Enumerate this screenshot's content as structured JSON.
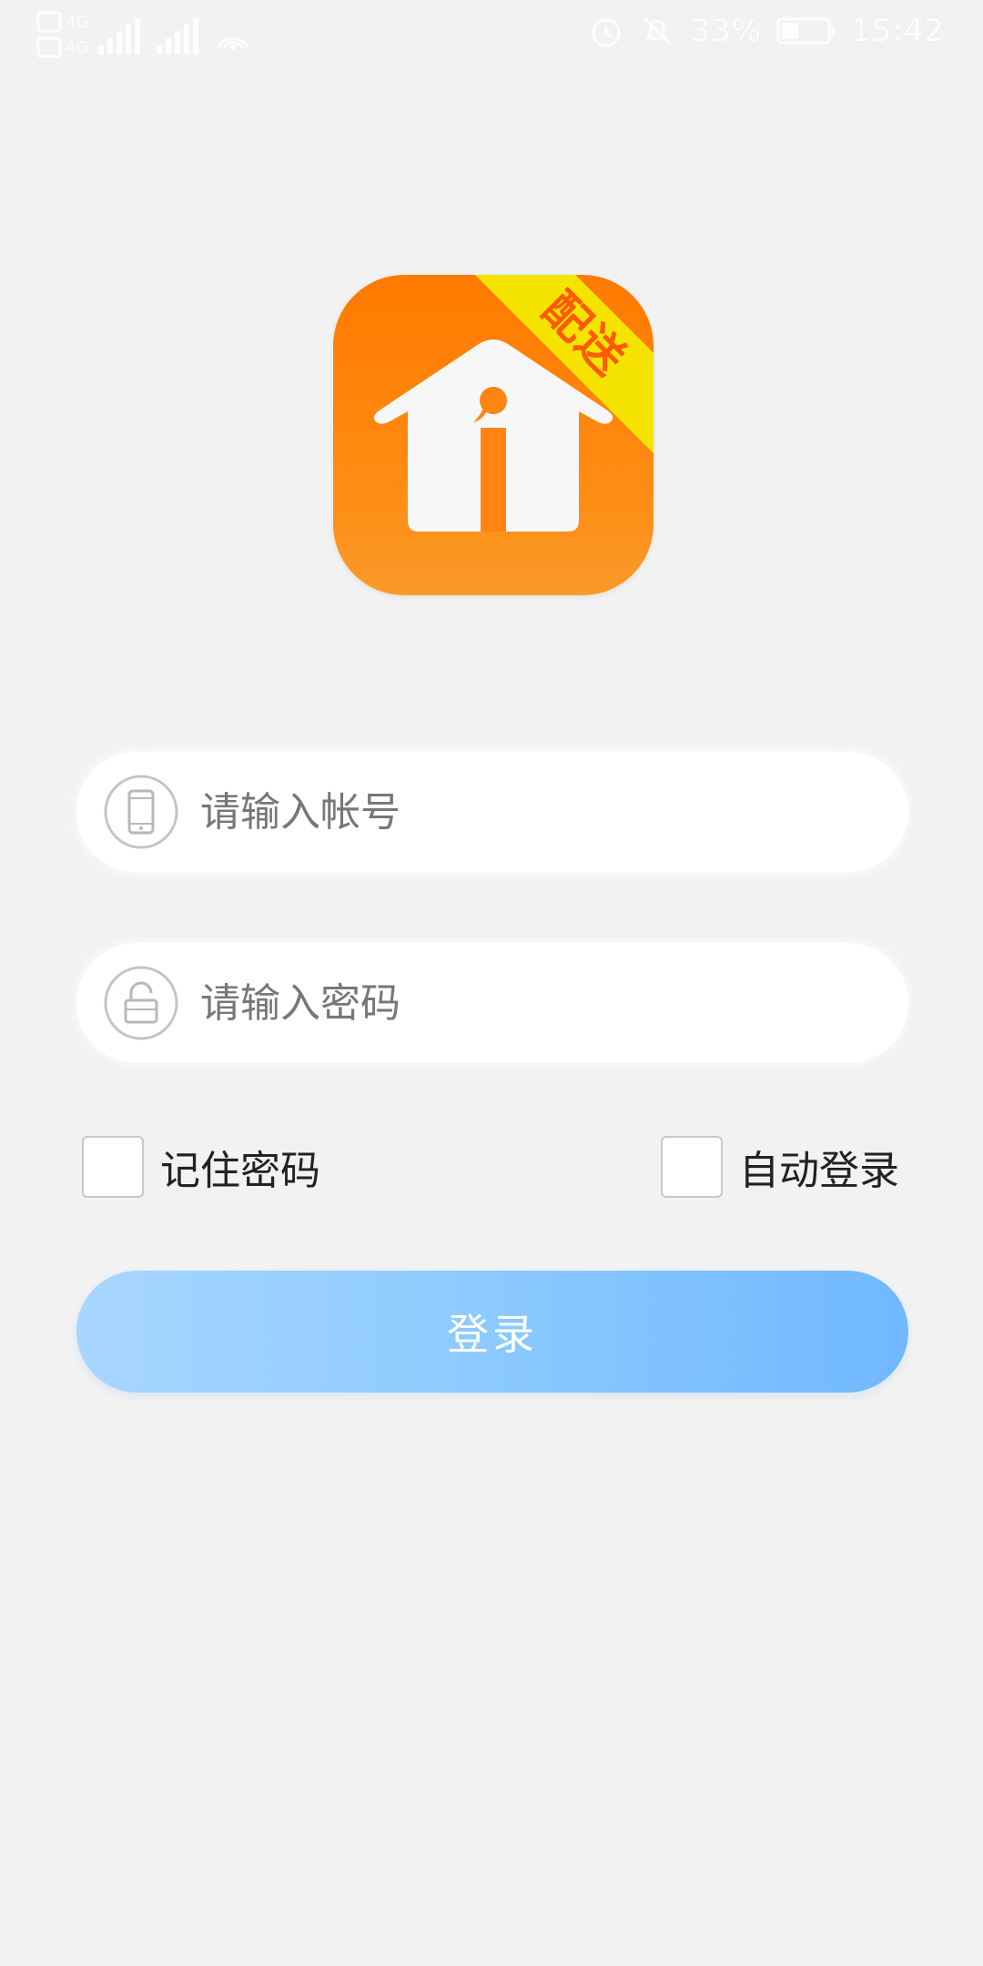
{
  "status_bar": {
    "battery_text": "33%",
    "time": "15:42"
  },
  "logo": {
    "ribbon_text": "配送",
    "colors": {
      "body": "#ff7a00",
      "ribbon": "#f5e400",
      "ribbon_text": "#ff5a00"
    }
  },
  "form": {
    "account_placeholder": "请输入帐号",
    "password_placeholder": "请输入密码",
    "remember_label": "记住密码",
    "auto_login_label": "自动登录",
    "login_label": "登录"
  },
  "colors": {
    "background": "#f2f2f2",
    "button_start": "#a8d6ff",
    "button_end": "#70b8ff"
  }
}
